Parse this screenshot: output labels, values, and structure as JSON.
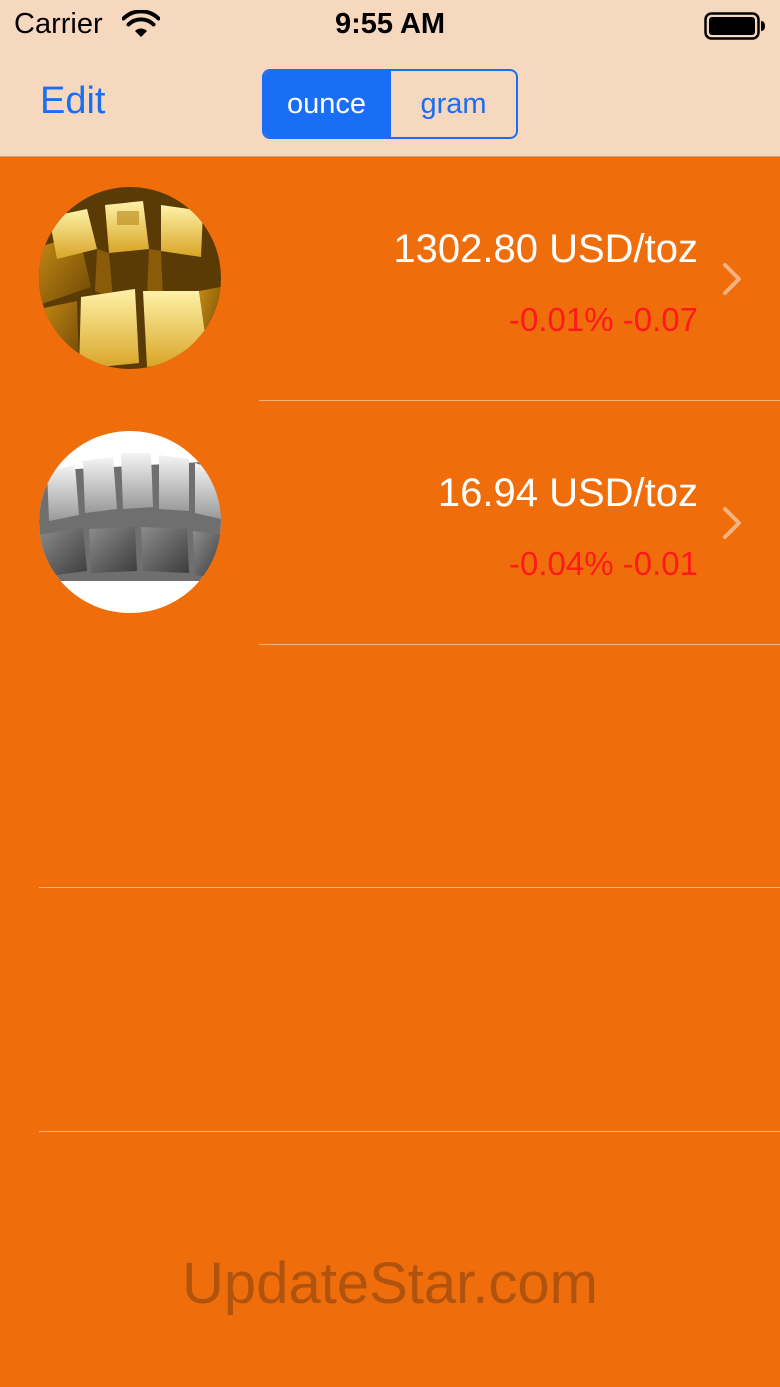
{
  "status_bar": {
    "carrier": "Carrier",
    "time": "9:55 AM",
    "wifi_icon": "wifi-icon",
    "battery_icon": "battery-icon"
  },
  "nav": {
    "edit_label": "Edit",
    "segments": [
      {
        "label": "ounce",
        "selected": true
      },
      {
        "label": "gram",
        "selected": false
      }
    ]
  },
  "metals": [
    {
      "image_icon": "gold-bars-image",
      "price": "1302.80 USD/toz",
      "change": "-0.01% -0.07"
    },
    {
      "image_icon": "silver-bars-image",
      "price": "16.94 USD/toz",
      "change": "-0.04% -0.01"
    }
  ],
  "watermark": "UpdateStar.com",
  "colors": {
    "background": "#ef6e0b",
    "nav_background": "#f6d8bf",
    "accent": "#1a6ef5",
    "negative": "#ff1a1a"
  }
}
